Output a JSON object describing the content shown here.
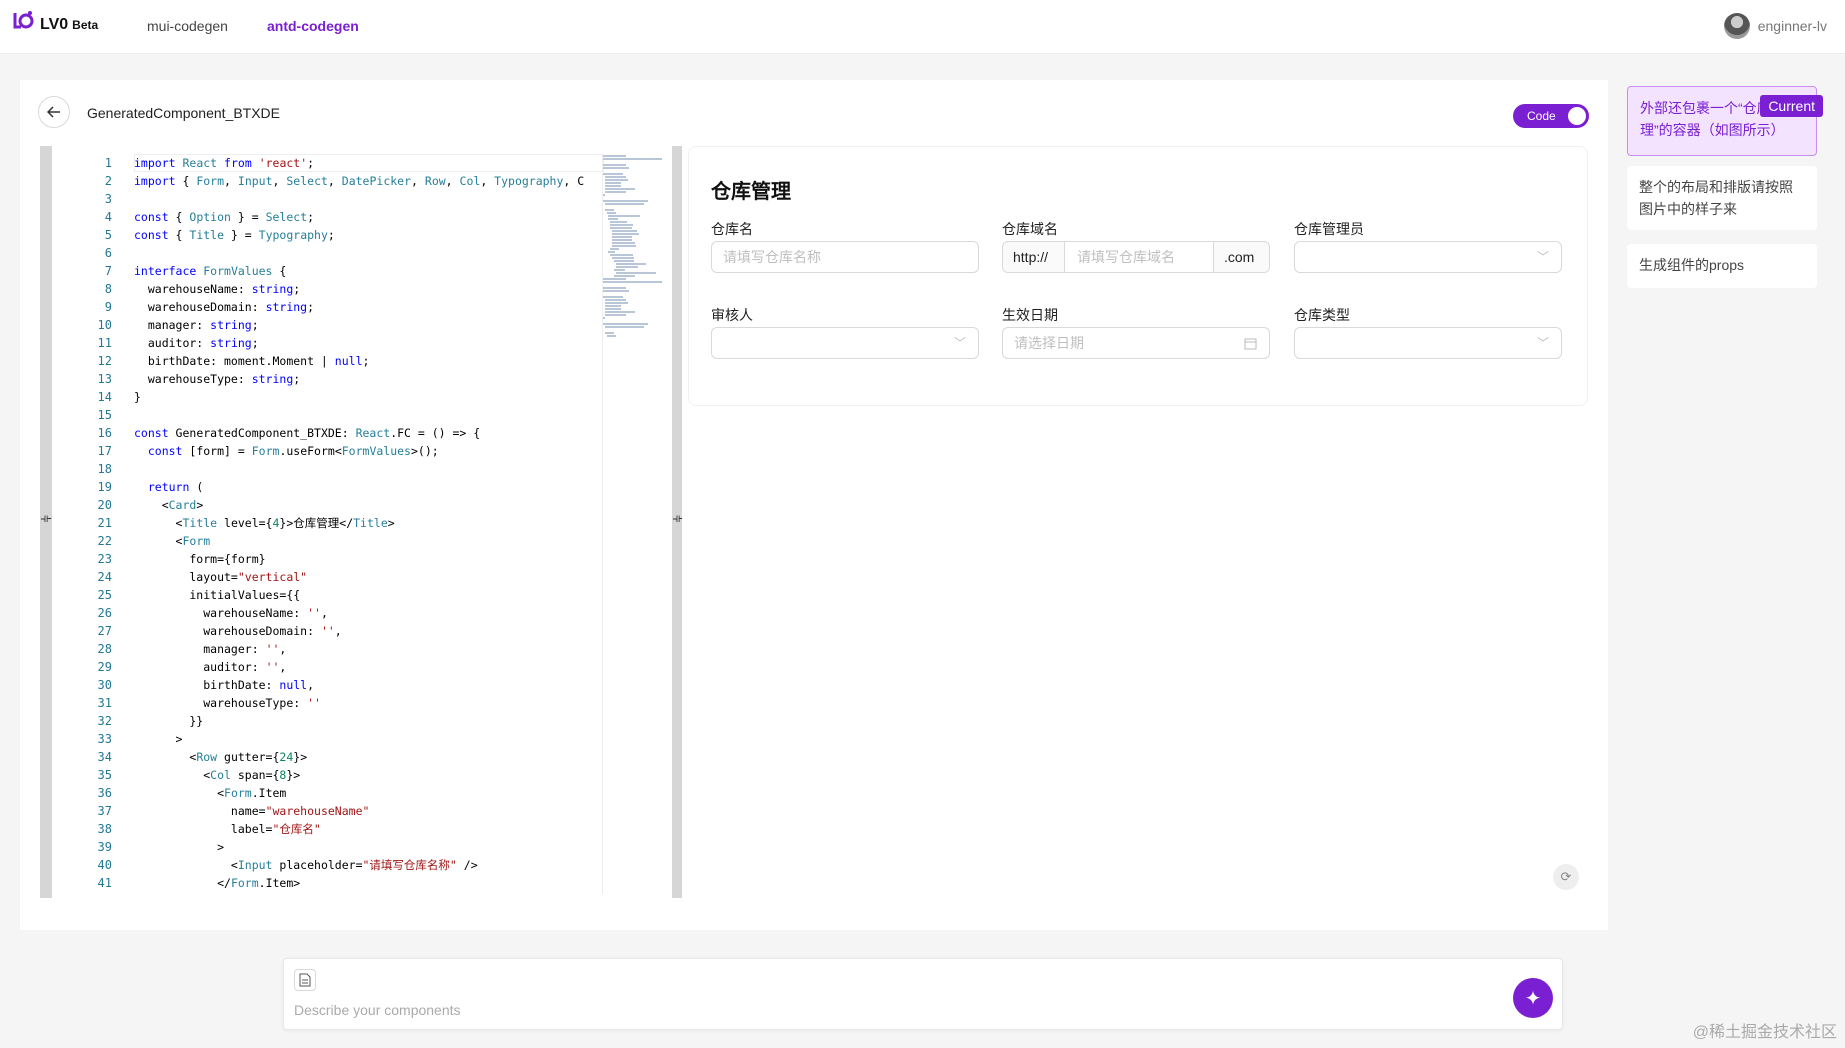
{
  "header": {
    "brand": "LV0",
    "beta": "Beta",
    "nav": [
      "mui-codegen",
      "antd-codegen"
    ],
    "user": "enginner-lv"
  },
  "main": {
    "component_name": "GeneratedComponent_BTXDE",
    "toggle_label": "Code"
  },
  "editor": {
    "line_numbers": [
      "1",
      "2",
      "3",
      "4",
      "5",
      "6",
      "7",
      "8",
      "9",
      "10",
      "11",
      "12",
      "13",
      "14",
      "15",
      "16",
      "17",
      "18",
      "19",
      "20",
      "21",
      "22",
      "23",
      "24",
      "25",
      "26",
      "27",
      "28",
      "29",
      "30",
      "31",
      "32",
      "33",
      "34",
      "35",
      "36",
      "37",
      "38",
      "39",
      "40",
      "41"
    ],
    "code": [
      "import React from 'react';",
      "import { Form, Input, Select, DatePicker, Row, Col, Typography, C",
      "",
      "const { Option } = Select;",
      "const { Title } = Typography;",
      "",
      "interface FormValues {",
      "  warehouseName: string;",
      "  warehouseDomain: string;",
      "  manager: string;",
      "  auditor: string;",
      "  birthDate: moment.Moment | null;",
      "  warehouseType: string;",
      "}",
      "",
      "const GeneratedComponent_BTXDE: React.FC = () => {",
      "  const [form] = Form.useForm<FormValues>();",
      "",
      "  return (",
      "    <Card>",
      "      <Title level={4}>仓库管理</Title>",
      "      <Form",
      "        form={form}",
      "        layout=\"vertical\"",
      "        initialValues={{",
      "          warehouseName: '',",
      "          warehouseDomain: '',",
      "          manager: '',",
      "          auditor: '',",
      "          birthDate: null,",
      "          warehouseType: ''",
      "        }}",
      "      >",
      "        <Row gutter={24}>",
      "          <Col span={8}>",
      "            <Form.Item",
      "              name=\"warehouseName\"",
      "              label=\"仓库名\"",
      "            >",
      "              <Input placeholder=\"请填写仓库名称\" />",
      "            </Form.Item>"
    ]
  },
  "preview": {
    "title": "仓库管理",
    "labels": {
      "warehouse_name": "仓库名",
      "warehouse_domain": "仓库域名",
      "manager": "仓库管理员",
      "auditor": "审核人",
      "effective_date": "生效日期",
      "warehouse_type": "仓库类型"
    },
    "placeholders": {
      "warehouse_name": "请填写仓库名称",
      "warehouse_domain": "请填写仓库域名",
      "effective_date": "请选择日期"
    },
    "domain_prefix": "http://",
    "domain_suffix": ".com"
  },
  "history": [
    {
      "text": "外部还包裹一个“仓库管理”的容器（如图所示）",
      "current": true
    },
    {
      "text": "整个的布局和排版请按照图片中的样子来",
      "current": false
    },
    {
      "text": "生成组件的props",
      "current": false
    }
  ],
  "history_badge": "Current",
  "prompt": {
    "placeholder": "Describe your components"
  },
  "watermark": "@稀土掘金技术社区",
  "colors": {
    "accent": "#7a1fd1",
    "accent_bg": "#f3e3ff"
  }
}
